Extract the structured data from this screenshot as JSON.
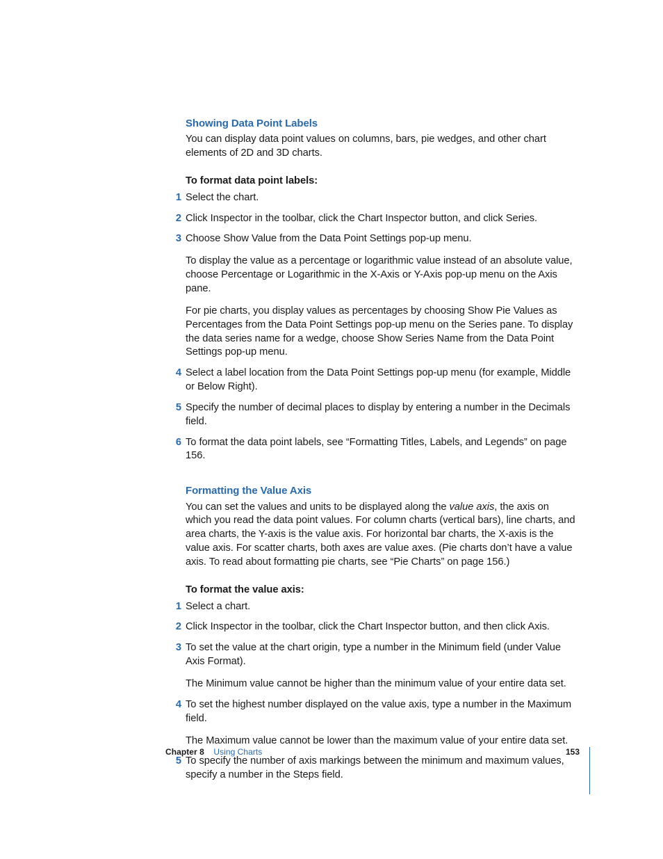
{
  "section1": {
    "title": "Showing Data Point Labels",
    "intro": "You can display data point values on columns, bars, pie wedges, and other chart elements of 2D and 3D charts.",
    "subhead": "To format data point labels:",
    "step1": "Select the chart.",
    "step2": "Click Inspector in the toolbar, click the Chart Inspector button, and click Series.",
    "step3a": "Choose Show Value from the Data Point Settings pop-up menu.",
    "step3b": "To display the value as a percentage or logarithmic value instead of an absolute value, choose Percentage or Logarithmic in the X-Axis or Y-Axis pop-up menu on the Axis pane.",
    "step3c": "For pie charts, you display values as percentages by choosing Show Pie Values as Percentages from the Data Point Settings pop-up menu on the Series pane. To display the data series name for a wedge, choose Show Series Name from the Data Point Settings pop-up menu.",
    "step4": "Select a label location from the Data Point Settings pop-up menu (for example, Middle or Below Right).",
    "step5": "Specify the number of decimal places to display by entering a number in the Decimals field.",
    "step6": "To format the data point labels, see “Formatting Titles, Labels, and Legends” on page 156."
  },
  "section2": {
    "title": "Formatting the Value Axis",
    "intro_pre": "You can set the values and units to be displayed along the ",
    "intro_italic": "value axis",
    "intro_post": ", the axis on which you read the data point values. For column charts (vertical bars), line charts, and area charts, the Y-axis is the value axis. For horizontal bar charts, the X-axis is the value axis. For scatter charts, both axes are value axes. (Pie charts don’t have a value axis. To read about formatting pie charts, see “Pie Charts” on page 156.)",
    "subhead": "To format the value axis:",
    "step1": "Select a chart.",
    "step2": "Click Inspector in the toolbar, click the Chart Inspector button, and then click Axis.",
    "step3a": "To set the value at the chart origin, type a number in the Minimum field (under Value Axis Format).",
    "step3b": "The Minimum value cannot be higher than the minimum value of your entire data set.",
    "step4a": "To set the highest number displayed on the value axis, type a number in the Maximum field.",
    "step4b": "The Maximum value cannot be lower than the maximum value of your entire data set.",
    "step5": "To specify the number of axis markings between the minimum and maximum values, specify a number in the Steps field."
  },
  "footer": {
    "chapter_label": "Chapter 8",
    "chapter_title": "Using Charts",
    "page_number": "153"
  }
}
